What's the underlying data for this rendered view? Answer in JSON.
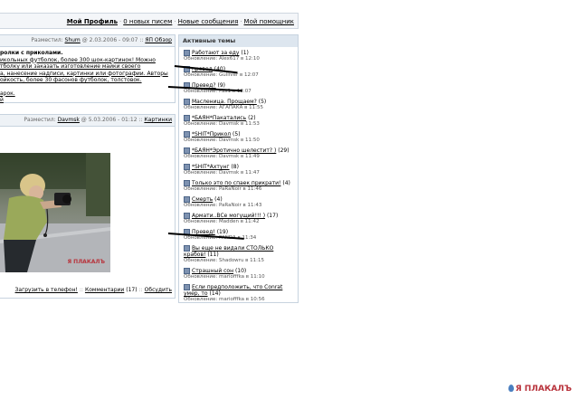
{
  "top_nav": {
    "profile": "Мой Профиль",
    "no_new_letters": "0 новых писем",
    "new_messages": "Новые сообщения",
    "my_helper": "Мой помощник"
  },
  "post1": {
    "posted_prefix": "Разместил:",
    "author": "Shum",
    "date": "@ 2.03.2006 - 09:07",
    "category": "ЯП Обзор",
    "lines": [
      "ролки с приколами.",
      "икольных футболок, более 300 шок-картинок! Можно",
      "тболку или заказать изготовление майки своего",
      "а, нанесение надписи, картинки или фотографии. Авторы",
      "ойкость, более 30 фасонов футболок, толстовок.",
      "",
      "арок.",
      "й"
    ]
  },
  "post2": {
    "posted_prefix": "Разместил:",
    "author": "Davmsk",
    "date": "@ 5.03.2006 - 01:12",
    "category": "Картинки",
    "photo_watermark": "Я ПЛАКАЛЪ",
    "download_label": "Загрузить в телефон!",
    "comments_label": "Комментарии",
    "comments_count": "(17)",
    "discuss_label": "Обсудить"
  },
  "sidebar": {
    "header": "Активные темы",
    "topics": [
      {
        "title": "Работают за еду",
        "count": "(1)",
        "update": "Обновление: Alex617 в 12:10"
      },
      {
        "title": "превед",
        "count": "(40)",
        "update": "Обновление: Gulliver в 12:07"
      },
      {
        "title": "Превед?",
        "count": "(9)",
        "update": "Обновление: Pax1 в 12:07"
      },
      {
        "title": "Масленица. Прощаем?",
        "count": "(5)",
        "update": "Обновление: АГАПАКА в 11:55"
      },
      {
        "title": "*БАЯН*Пакатались",
        "count": "(2)",
        "update": "Обновление: Davmsk в 11:53"
      },
      {
        "title": "*SHIT*Прикол",
        "count": "(5)",
        "update": "Обновление: Davmsk в 11:50"
      },
      {
        "title": "*БАЯН*Эротично шелестит? )",
        "count": "(29)",
        "update": "Обновление: Davmsk в 11:49"
      },
      {
        "title": "*SHIT*Ахтунг",
        "count": "(8)",
        "update": "Обновление: Davmsk в 11:47"
      },
      {
        "title": "Только это по спаек прикрати!",
        "count": "(4)",
        "update": "Обновление: PaRaNoir в 11:46"
      },
      {
        "title": "Смерть",
        "count": "(4)",
        "update": "Обновление: PaRaNoir в 11:43"
      },
      {
        "title": "Армати..ВСе могущий!!! )",
        "count": "(17)",
        "update": "Обновление: Madden в 11:42"
      },
      {
        "title": "Превед!",
        "count": "(19)",
        "update": "Обновление: PANDA в 11:34"
      },
      {
        "title": "Вы еще не видали СТОЛЬКО крабов!",
        "count": "(11)",
        "update": "Обновление: Shadowru в 11:15"
      },
      {
        "title": "Страшный сон",
        "count": "(10)",
        "update": "Обновление: mariofffka в 11:10"
      },
      {
        "title": "Если предположить, что Conrat умер, то",
        "count": "(14)",
        "update": "Обновление: mariofffka в 10:56"
      }
    ]
  },
  "watermark": "Я ПЛАКАЛЪ",
  "colors": {
    "accent": "#b8323b",
    "header_bg": "#dde6ef",
    "border": "#c7d3df",
    "icon": "#7e92b0"
  }
}
